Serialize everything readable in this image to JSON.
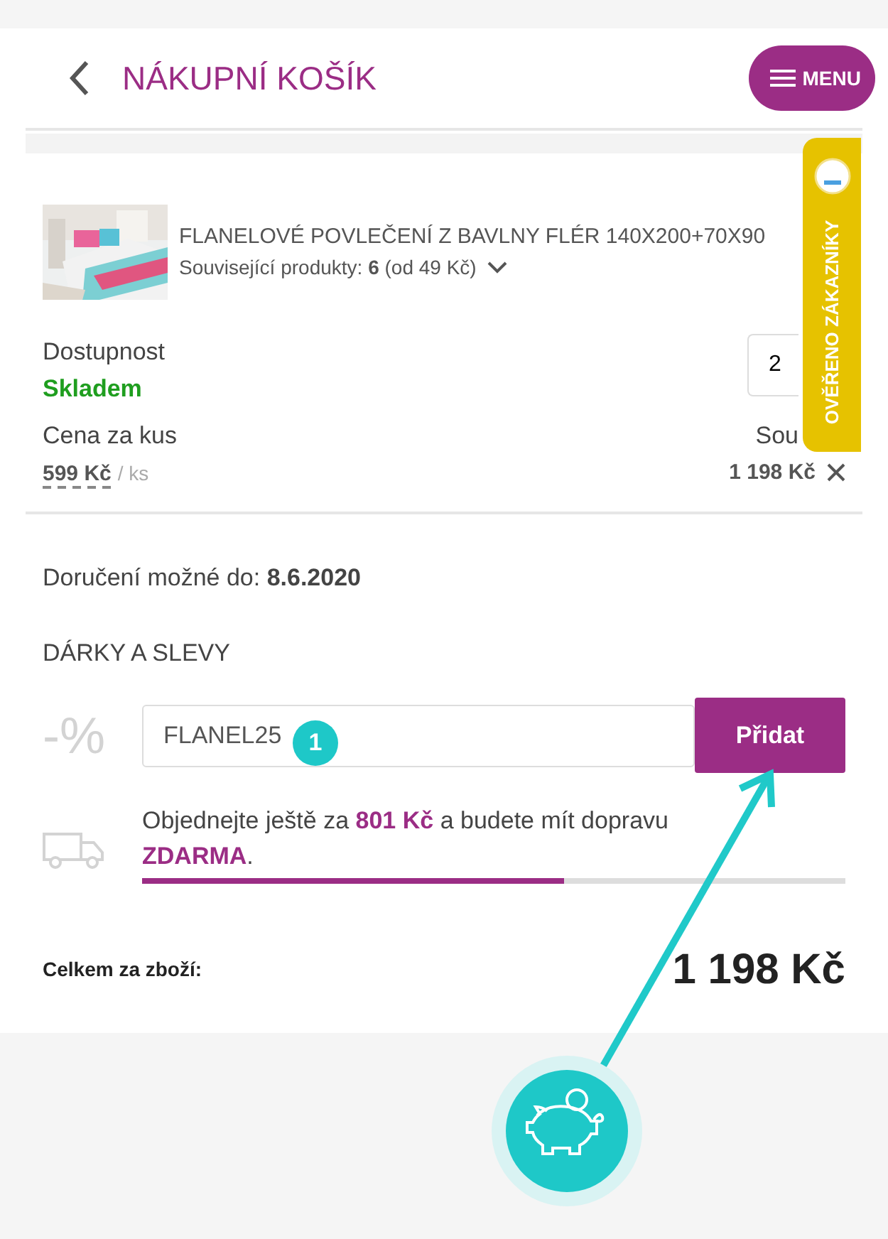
{
  "header": {
    "title": "NÁKUPNÍ KOŠÍK",
    "menu_label": "MENU"
  },
  "product": {
    "kind": "picture",
    "name": "FLANELOVÉ POVLEČENÍ Z BAVLNY FLÉR 140X200+70X90",
    "related": "Související produkty: **6** (od 49 Kč)"
  },
  "availability": {
    "label": "Dostupnost",
    "status": "Skladem"
  },
  "quantity": "2",
  "price": {
    "label": "Cena za kus",
    "value": "599 Kč",
    "unit": "/ ks"
  },
  "sum": {
    "label": "Sou",
    "value": "1 198 Kč"
  },
  "delivery": "Doručení možné do: **8.6.2020**",
  "gifts": {
    "heading": "DÁRKY A SLEVY",
    "icon": "-%",
    "coupon": "FLANEL25",
    "button": "Přidat"
  },
  "shipping": {
    "text": "Objednejte ještě za **801 Kč** a budete mít dopravu **ZDARMA**.",
    "level": 0.6
  },
  "total": {
    "label": "Celkem za zboží:",
    "value": "1 198 Kč"
  },
  "verified_tab": {
    "label": "OVĚŘENO ZÁKAZNÍKY"
  },
  "step_badge": "1"
}
